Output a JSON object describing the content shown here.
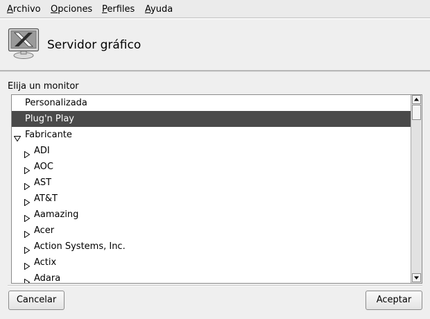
{
  "menu": [
    {
      "mnemonic": "A",
      "rest": "rchivo"
    },
    {
      "mnemonic": "O",
      "rest": "pciones"
    },
    {
      "mnemonic": "P",
      "rest": "erfiles"
    },
    {
      "mnemonic": "A",
      "rest": "yuda"
    }
  ],
  "header": {
    "title": "Servidor gráfico",
    "icon": "x-server-monitor-icon"
  },
  "section": {
    "label": "Elija un monitor"
  },
  "list": {
    "items": [
      {
        "label": "Personalizada",
        "expander": "none"
      },
      {
        "label": "Plug'n Play",
        "expander": "none",
        "selected": true
      },
      {
        "label": "Fabricante",
        "expander": "expanded"
      },
      {
        "label": "ADI",
        "expander": "collapsed"
      },
      {
        "label": "AOC",
        "expander": "collapsed"
      },
      {
        "label": "AST",
        "expander": "collapsed"
      },
      {
        "label": "AT&T",
        "expander": "collapsed"
      },
      {
        "label": "Aamazing",
        "expander": "collapsed"
      },
      {
        "label": "Acer",
        "expander": "collapsed"
      },
      {
        "label": "Action Systems, Inc.",
        "expander": "collapsed"
      },
      {
        "label": "Actix",
        "expander": "collapsed"
      },
      {
        "label": "Adara",
        "expander": "collapsed"
      }
    ]
  },
  "buttons": {
    "cancel": "Cancelar",
    "ok": "Aceptar"
  },
  "colors": {
    "selection": "#4a4a4a",
    "background": "#efefef"
  }
}
